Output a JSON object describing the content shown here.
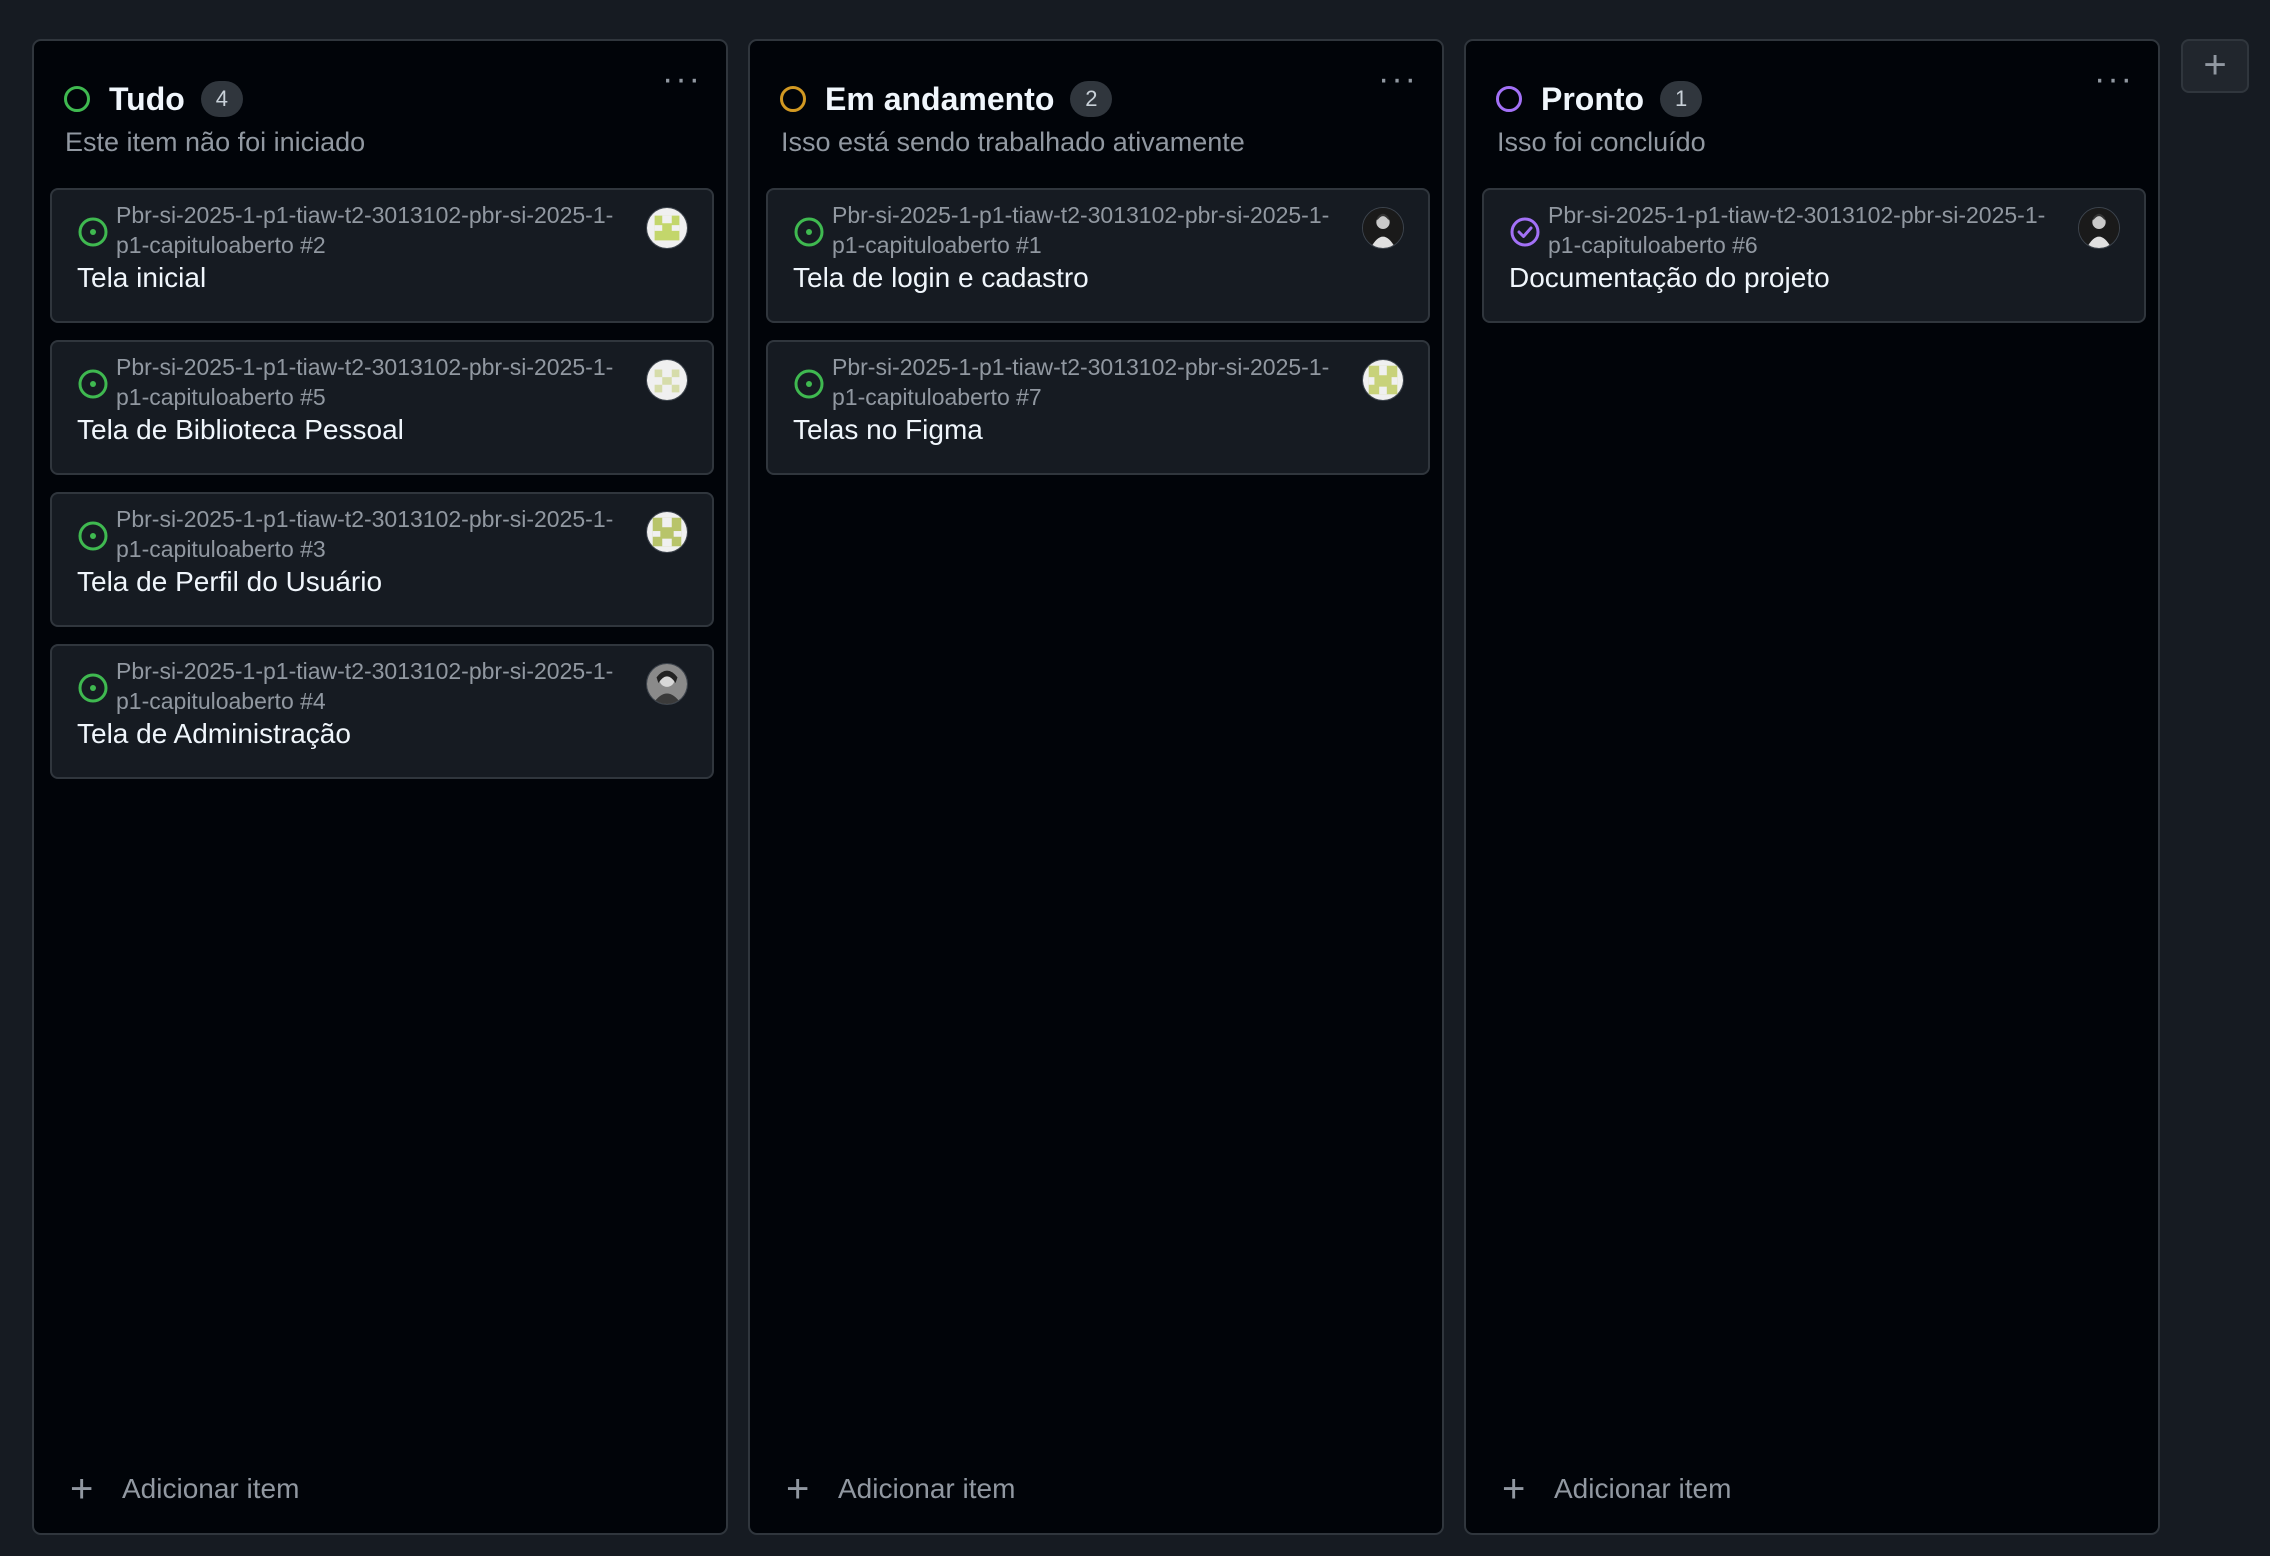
{
  "colors": {
    "todo": "#3fb950",
    "in_progress": "#d29922",
    "done": "#a371f7",
    "issue_open": "#3fb950",
    "issue_closed": "#a371f7"
  },
  "columns": [
    {
      "title": "Tudo",
      "count": "4",
      "description": "Este item não foi iniciado",
      "menu_label": "···",
      "status_icon": "status-circle-green",
      "add_label": "Adicionar item",
      "cards": [
        {
          "ref": "Pbr-si-2025-1-p1-tiaw-t2-3013102-pbr-si-2025-1-p1-capituloaberto #2",
          "title": "Tela inicial",
          "icon": "issue-open-icon",
          "avatar": "avatar-identicon"
        },
        {
          "ref": "Pbr-si-2025-1-p1-tiaw-t2-3013102-pbr-si-2025-1-p1-capituloaberto #5",
          "title": "Tela de Biblioteca Pessoal",
          "icon": "issue-open-icon",
          "avatar": "avatar-identicon"
        },
        {
          "ref": "Pbr-si-2025-1-p1-tiaw-t2-3013102-pbr-si-2025-1-p1-capituloaberto #3",
          "title": "Tela de Perfil do Usuário",
          "icon": "issue-open-icon",
          "avatar": "avatar-identicon"
        },
        {
          "ref": "Pbr-si-2025-1-p1-tiaw-t2-3013102-pbr-si-2025-1-p1-capituloaberto #4",
          "title": "Tela de Administração",
          "icon": "issue-open-icon",
          "avatar": "avatar-photo"
        }
      ]
    },
    {
      "title": "Em andamento",
      "count": "2",
      "description": "Isso está sendo trabalhado ativamente",
      "menu_label": "···",
      "status_icon": "status-circle-orange",
      "add_label": "Adicionar item",
      "cards": [
        {
          "ref": "Pbr-si-2025-1-p1-tiaw-t2-3013102-pbr-si-2025-1-p1-capituloaberto #1",
          "title": "Tela de login e cadastro",
          "icon": "issue-open-icon",
          "avatar": "avatar-photo"
        },
        {
          "ref": "Pbr-si-2025-1-p1-tiaw-t2-3013102-pbr-si-2025-1-p1-capituloaberto #7",
          "title": "Telas no Figma",
          "icon": "issue-open-icon",
          "avatar": "avatar-identicon"
        }
      ]
    },
    {
      "title": "Pronto",
      "count": "1",
      "description": "Isso foi concluído",
      "menu_label": "···",
      "status_icon": "status-circle-purple",
      "add_label": "Adicionar item",
      "cards": [
        {
          "ref": "Pbr-si-2025-1-p1-tiaw-t2-3013102-pbr-si-2025-1-p1-capituloaberto #6",
          "title": "Documentação do projeto",
          "icon": "issue-closed-icon",
          "avatar": "avatar-photo"
        }
      ]
    }
  ],
  "add_column_label": "+"
}
